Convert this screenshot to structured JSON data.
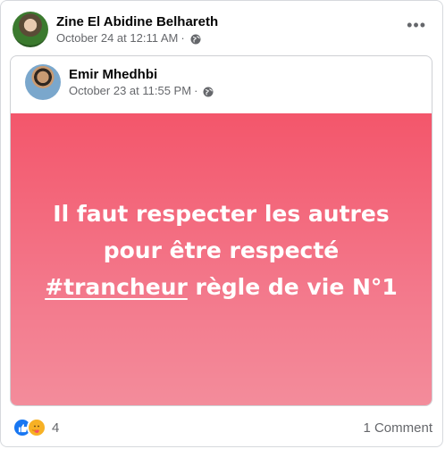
{
  "post": {
    "author": "Zine El Abidine Belhareth",
    "timestamp": "October 24 at 12:11 AM",
    "separator": "·",
    "privacy_icon": "globe-icon",
    "more_icon": "more-options-icon",
    "more_label": "•••"
  },
  "shared_post": {
    "author": "Emir Mhedhbi",
    "timestamp": "October 23 at 11:55 PM",
    "separator": "·",
    "privacy_icon": "globe-icon",
    "text_line1": "Il faut respecter les autres",
    "text_line2": "pour être respecté",
    "hashtag": "#trancheur",
    "text_line3_rest": " règle de vie N°1",
    "background_colors": [
      "#f3566b",
      "#f38c9b"
    ]
  },
  "footer": {
    "reactions": [
      "like-icon",
      "care-icon"
    ],
    "reaction_count": "4",
    "comments": "1 Comment"
  },
  "colors": {
    "like_blue": "#1877f2",
    "secondary_text": "#65676b"
  }
}
